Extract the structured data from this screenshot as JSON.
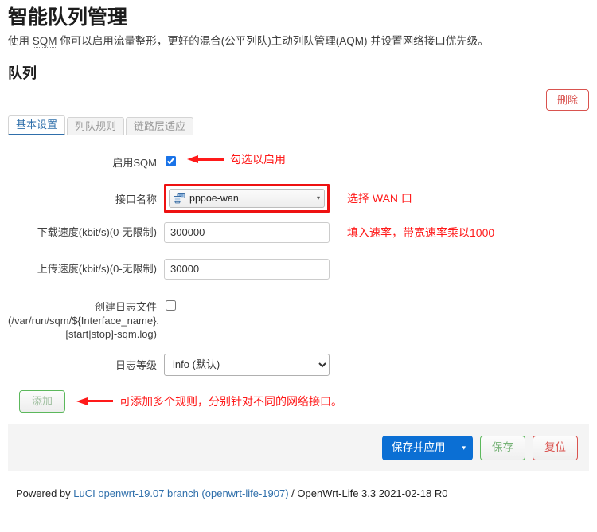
{
  "header": {
    "title": "智能队列管理",
    "description_before": "使用 ",
    "description_abbr": "SQM",
    "description_after": " 你可以启用流量整形，更好的混合(公平列队)主动列队管理(AQM) 并设置网络接口优先级。",
    "section_title": "队列"
  },
  "delete_button": {
    "label": "删除"
  },
  "tabs": [
    {
      "label": "基本设置",
      "active": true
    },
    {
      "label": "列队规则",
      "active": false
    },
    {
      "label": "链路层适应",
      "active": false
    }
  ],
  "form": {
    "enable_sqm": {
      "label": "启用SQM",
      "checked": true,
      "annotation": "勾选以启用"
    },
    "interface_name": {
      "label": "接口名称",
      "value": "pppoe-wan",
      "icon": "network-computers-icon",
      "caret": "▾",
      "annotation": "选择 WAN 口",
      "highlight_color": "#ee1111"
    },
    "download_speed": {
      "label": "下载速度(kbit/s)(0-无限制)",
      "value": "300000",
      "placeholder": "",
      "annotation": "填入速率，带宽速率乘以1000"
    },
    "upload_speed": {
      "label": "上传速度(kbit/s)(0-无限制)",
      "value": "30000",
      "placeholder": "",
      "annotation": ""
    },
    "create_log": {
      "label_line1": "创建日志文件",
      "label_line2": "(/var/run/sqm/${Interface_name}.",
      "label_line3": "[start|stop]-sqm.log)",
      "checked": false
    },
    "log_level": {
      "label": "日志等级",
      "value": "info (默认)",
      "options": [
        "info (默认)"
      ]
    }
  },
  "add_section": {
    "button_label": "添加",
    "annotation": "可添加多个规则，分别针对不同的网络接口。"
  },
  "actionbar": {
    "apply_label": "保存并应用",
    "apply_caret": "▾",
    "save_label": "保存",
    "reset_label": "复位"
  },
  "footer": {
    "powered_text": "Powered by ",
    "luci_link": "LuCI openwrt-19.07 branch (openwrt-life-1907)",
    "tail_text": " / OpenWrt-Life 3.3 2021-02-18 R0"
  },
  "colors": {
    "accent_blue": "#2f6fab",
    "annotation_red": "#ff1a1a",
    "danger": "#d9534f",
    "success": "#5cb85c",
    "primary": "#0b6fd4"
  }
}
